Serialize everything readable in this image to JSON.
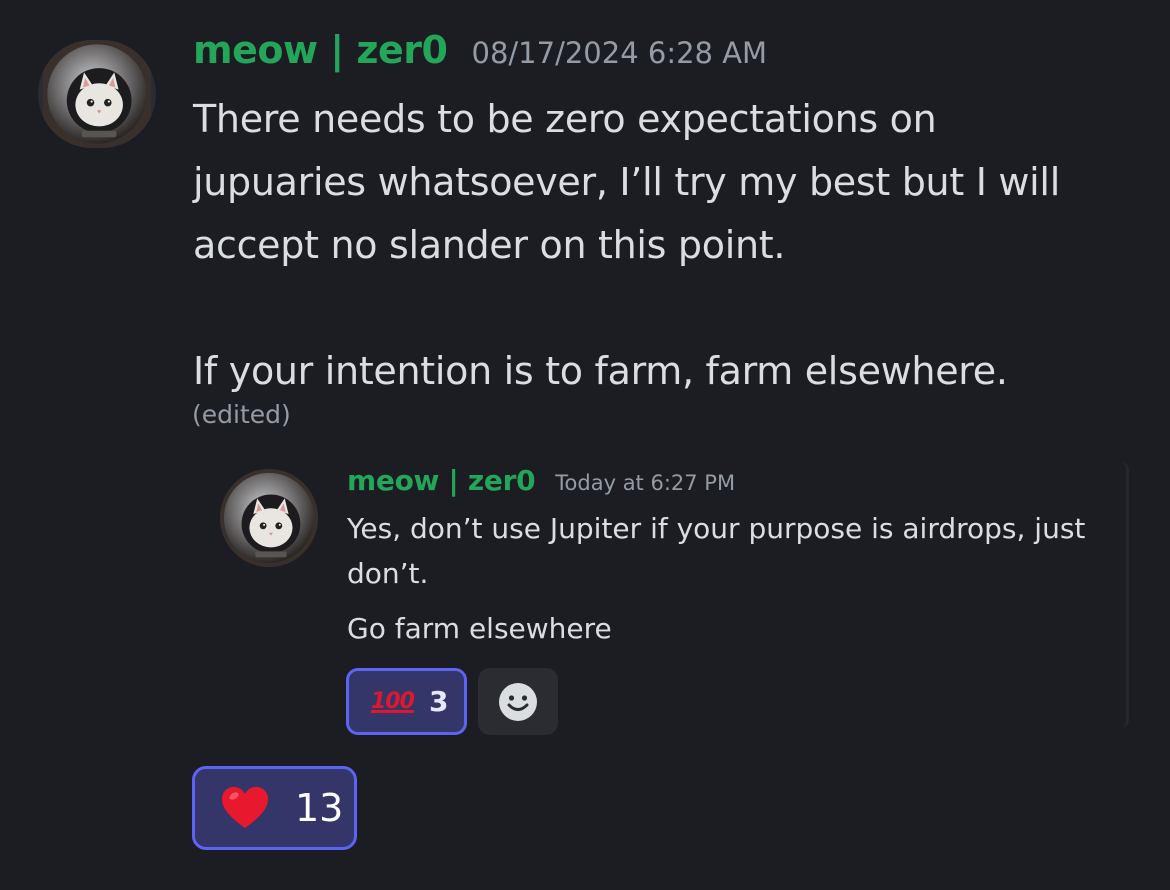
{
  "main_message": {
    "username": "meow | zer0",
    "timestamp": "08/17/2024 6:28 AM",
    "lines": [
      "There needs to be zero expectations on",
      "jupuaries whatsoever, I’ll try my best but I will",
      "accept no slander on this point.",
      "If your intention is to farm, farm elsewhere."
    ],
    "edited_label": "(edited)",
    "avatar_icon": "astronaut-cat-avatar"
  },
  "reply_message": {
    "username": "meow | zer0",
    "timestamp": "Today at 6:27 PM",
    "paragraphs": [
      "Yes, don’t use Jupiter if your purpose is airdrops, just don’t.",
      "Go farm elsewhere"
    ],
    "avatar_icon": "astronaut-cat-avatar"
  },
  "reactions": {
    "reply": [
      {
        "emoji": "100",
        "icon": "hundred-points-emoji",
        "count": "3"
      }
    ],
    "add_reaction_icon": "smiley-icon",
    "main": [
      {
        "icon": "red-heart-emoji",
        "count": "13"
      }
    ]
  },
  "colors": {
    "background": "#1c1d22",
    "username": "#23a55a",
    "text": "#dbdee1",
    "muted": "#949ba4",
    "reaction_active_bg": "#343669",
    "reaction_active_border": "#5c64f4",
    "hundred_red": "#e0182c",
    "heart_red": "#e8182e"
  }
}
